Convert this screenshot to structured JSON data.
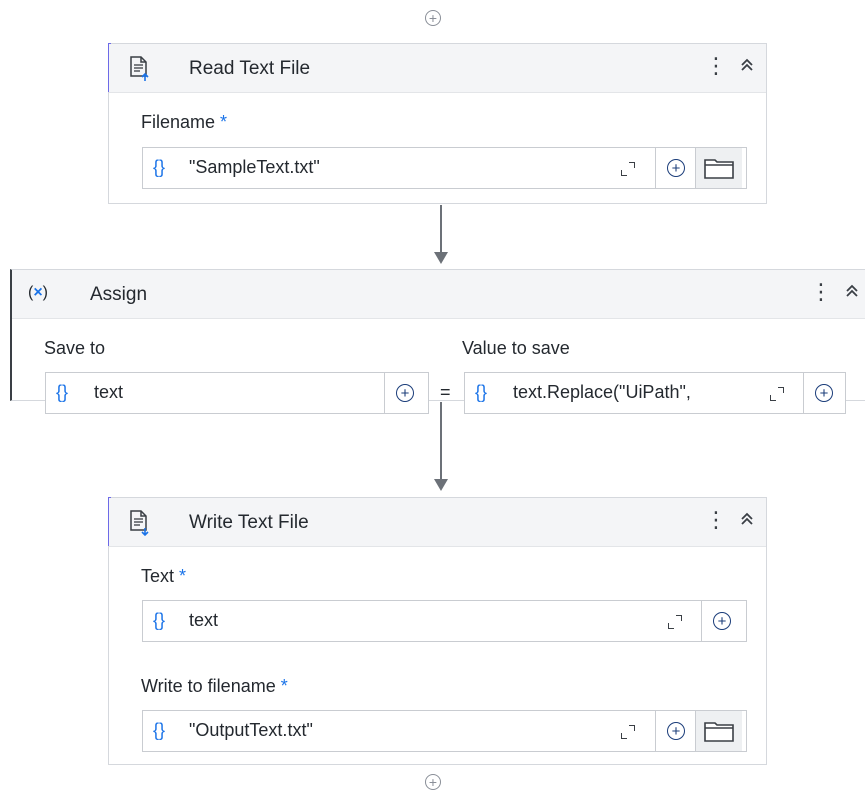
{
  "read_activity": {
    "title": "Read Text File",
    "icon": "document-read-icon",
    "menu_label": "⋮",
    "collapse_label": "⌃",
    "fields": [
      {
        "label": "Filename",
        "required_marker": "*",
        "value": "\"SampleText.txt\"",
        "expression_icon": "{}"
      }
    ]
  },
  "assign_activity": {
    "title": "Assign",
    "icon_label": "(x)",
    "menu_label": "⋮",
    "collapse_label": "⌃",
    "save_to": {
      "label": "Save to",
      "value": "text",
      "expression_icon": "{}"
    },
    "equals": "=",
    "value_to_save": {
      "label": "Value to save",
      "value": "text.Replace(\"UiPath\",",
      "expression_icon": "{}"
    }
  },
  "write_activity": {
    "title": "Write Text File",
    "icon": "document-write-icon",
    "menu_label": "⋮",
    "collapse_label": "⌃",
    "fields": [
      {
        "label": "Text",
        "required_marker": "*",
        "value": "text",
        "expression_icon": "{}"
      },
      {
        "label": "Write to filename",
        "required_marker": "*",
        "value": "\"OutputText.txt\"",
        "expression_icon": "{}"
      }
    ]
  },
  "colors": {
    "accent": "#6d6ae8",
    "expression": "#1a73e8",
    "connector": "#6c7178"
  }
}
